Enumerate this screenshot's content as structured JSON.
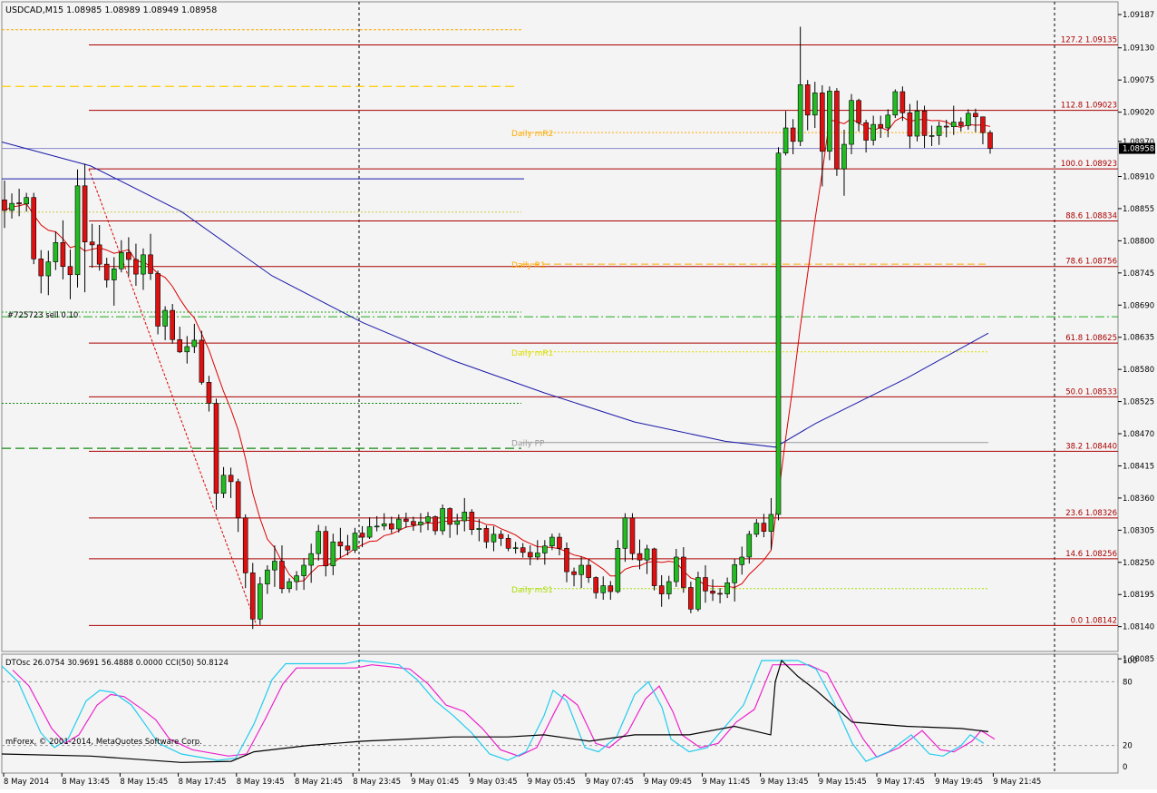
{
  "window": {
    "header": "USDCAD,M15  1.08985 1.08989 1.08949 1.08958",
    "order_label": "#725723 sell 0.10",
    "copyright": "mForex, © 2001-2014, MetaQuotes Software Corp."
  },
  "colors": {
    "background": "#f4f4f4",
    "bull_candle": "#22bb22",
    "bear_candle": "#dd1111",
    "fib": "#aa0000",
    "sma_fast": "#dd0000",
    "sma_slow": "#1a1aaa",
    "pivot_orange": "#ffaa00",
    "pivot_green": "#22aa22",
    "dtosc_fast": "#22ccee",
    "dtosc_slow": "#ee22cc",
    "cci": "#000000"
  },
  "chart_data": {
    "type": "candlestick",
    "symbol": "USDCAD",
    "timeframe": "M15",
    "ylim": [
      1.0811,
      1.09187
    ],
    "y_ticks": [
      "1.09187",
      "1.09130",
      "1.09075",
      "1.09020",
      "1.08970",
      "1.08910",
      "1.08855",
      "1.08800",
      "1.08745",
      "1.08690",
      "1.08635",
      "1.08580",
      "1.08525",
      "1.08470",
      "1.08415",
      "1.08360",
      "1.08305",
      "1.08250",
      "1.08195",
      "1.08140",
      "1.08085"
    ],
    "y_tick_values": [
      1.09187,
      1.0913,
      1.09075,
      1.0902,
      1.0897,
      1.0891,
      1.08855,
      1.088,
      1.08745,
      1.0869,
      1.08635,
      1.0858,
      1.08525,
      1.0847,
      1.08415,
      1.0836,
      1.08305,
      1.0825,
      1.08195,
      1.0814,
      1.08085
    ],
    "current_price": {
      "label": "1.08958",
      "value": 1.08958
    },
    "x_ticks": [
      "8 May 2014",
      "8 May 13:45",
      "8 May 15:45",
      "8 May 17:45",
      "8 May 19:45",
      "8 May 21:45",
      "8 May 23:45",
      "9 May 01:45",
      "9 May 03:45",
      "9 May 05:45",
      "9 May 07:45",
      "9 May 09:45",
      "9 May 11:45",
      "9 May 13:45",
      "9 May 15:45",
      "9 May 17:45",
      "9 May 19:45",
      "9 May 21:45"
    ],
    "fib_levels": [
      {
        "label": "127.2 1.09135",
        "value": 1.09135
      },
      {
        "label": "112.8 1.09023",
        "value": 1.09023
      },
      {
        "label": "100.0 1.08923",
        "value": 1.08923
      },
      {
        "label": "88.6 1.08834",
        "value": 1.08834
      },
      {
        "label": "78.6 1.08756",
        "value": 1.08756
      },
      {
        "label": "61.8 1.08625",
        "value": 1.08625
      },
      {
        "label": "50.0 1.08533",
        "value": 1.08533
      },
      {
        "label": "38.2 1.08440",
        "value": 1.0844
      },
      {
        "label": "23.6 1.08326",
        "value": 1.08326
      },
      {
        "label": "14.6 1.08256",
        "value": 1.08256
      },
      {
        "label": "0.0 1.08142",
        "value": 1.08142
      }
    ],
    "pivots": [
      {
        "label": "Daily mR2",
        "value": 1.08985,
        "color": "#ffaa00",
        "style": "dot"
      },
      {
        "label": "Daily R1",
        "value": 1.0876,
        "color": "#ffaa00",
        "style": "dash"
      },
      {
        "label": "Daily mR1",
        "value": 1.0861,
        "color": "#dddd00",
        "style": "dot"
      },
      {
        "label": "Daily PP",
        "value": 1.08455,
        "color": "#999999",
        "style": "solid"
      },
      {
        "label": "Daily mS1",
        "value": 1.08205,
        "color": "#aadd00",
        "style": "dot"
      }
    ],
    "candles": [
      [
        1.0887,
        1.08903,
        1.08822,
        1.08852
      ],
      [
        1.08852,
        1.08881,
        1.08838,
        1.08864
      ],
      [
        1.08865,
        1.08889,
        1.08842,
        1.08863
      ],
      [
        1.08863,
        1.08882,
        1.0885,
        1.08874
      ],
      [
        1.08874,
        1.08882,
        1.0876,
        1.08769
      ],
      [
        1.08769,
        1.08784,
        1.0871,
        1.0874
      ],
      [
        1.0874,
        1.08783,
        1.08707,
        1.08764
      ],
      [
        1.08764,
        1.08816,
        1.0875,
        1.08797
      ],
      [
        1.08797,
        1.08835,
        1.08734,
        1.08756
      ],
      [
        1.08756,
        1.08785,
        1.087,
        1.08742
      ],
      [
        1.08742,
        1.08922,
        1.0872,
        1.08894
      ],
      [
        1.08894,
        1.08932,
        1.08712,
        1.08798
      ],
      [
        1.08798,
        1.08829,
        1.08754,
        1.08793
      ],
      [
        1.08793,
        1.08827,
        1.08749,
        1.0876
      ],
      [
        1.0876,
        1.08771,
        1.0872,
        1.08733
      ],
      [
        1.08733,
        1.08772,
        1.08689,
        1.08752
      ],
      [
        1.08752,
        1.08801,
        1.08746,
        1.0878
      ],
      [
        1.0878,
        1.08806,
        1.0874,
        1.08768
      ],
      [
        1.08768,
        1.08795,
        1.08723,
        1.08743
      ],
      [
        1.08743,
        1.08787,
        1.08716,
        1.08776
      ],
      [
        1.08776,
        1.08812,
        1.08733,
        1.08744
      ],
      [
        1.08744,
        1.08749,
        1.0864,
        1.08654
      ],
      [
        1.08654,
        1.08688,
        1.0863,
        1.08681
      ],
      [
        1.08681,
        1.08692,
        1.08624,
        1.08631
      ],
      [
        1.08631,
        1.08653,
        1.08608,
        1.0861
      ],
      [
        1.0861,
        1.08637,
        1.0859,
        1.08619
      ],
      [
        1.08619,
        1.08658,
        1.08608,
        1.0863
      ],
      [
        1.0863,
        1.08646,
        1.08554,
        1.08558
      ],
      [
        1.08558,
        1.08569,
        1.08508,
        1.08522
      ],
      [
        1.08522,
        1.0853,
        1.0834,
        1.08368
      ],
      [
        1.08368,
        1.08413,
        1.0836,
        1.08399
      ],
      [
        1.08399,
        1.08412,
        1.0836,
        1.08388
      ],
      [
        1.08388,
        1.08393,
        1.08302,
        1.08326
      ],
      [
        1.08326,
        1.08332,
        1.08206,
        1.08232
      ],
      [
        1.08232,
        1.08249,
        1.08136,
        1.08153
      ],
      [
        1.08153,
        1.08225,
        1.08143,
        1.08213
      ],
      [
        1.08213,
        1.08245,
        1.08196,
        1.08237
      ],
      [
        1.08237,
        1.08279,
        1.08208,
        1.08252
      ],
      [
        1.08252,
        1.08279,
        1.08197,
        1.08205
      ],
      [
        1.08205,
        1.08223,
        1.08198,
        1.08217
      ],
      [
        1.08217,
        1.08235,
        1.08202,
        1.08227
      ],
      [
        1.08227,
        1.08257,
        1.08203,
        1.08245
      ],
      [
        1.08245,
        1.08282,
        1.08215,
        1.08265
      ],
      [
        1.08265,
        1.08314,
        1.08253,
        1.08303
      ],
      [
        1.08303,
        1.08312,
        1.08226,
        1.08244
      ],
      [
        1.08244,
        1.08299,
        1.08228,
        1.08285
      ],
      [
        1.08285,
        1.08309,
        1.08258,
        1.08278
      ],
      [
        1.08278,
        1.08297,
        1.08262,
        1.08271
      ],
      [
        1.08271,
        1.08309,
        1.08266,
        1.083
      ],
      [
        1.083,
        1.08312,
        1.08276,
        1.08293
      ],
      [
        1.08293,
        1.08327,
        1.0829,
        1.08311
      ],
      [
        1.08311,
        1.08329,
        1.08303,
        1.08312
      ],
      [
        1.08312,
        1.08334,
        1.08305,
        1.08316
      ],
      [
        1.08316,
        1.08328,
        1.083,
        1.08307
      ],
      [
        1.08307,
        1.08332,
        1.08301,
        1.08324
      ],
      [
        1.08324,
        1.08335,
        1.08309,
        1.0832
      ],
      [
        1.0832,
        1.08328,
        1.08304,
        1.08314
      ],
      [
        1.08314,
        1.08334,
        1.08301,
        1.08319
      ],
      [
        1.08319,
        1.08336,
        1.08305,
        1.08328
      ],
      [
        1.08328,
        1.0833,
        1.08297,
        1.08304
      ],
      [
        1.08304,
        1.08349,
        1.08297,
        1.08342
      ],
      [
        1.08342,
        1.08344,
        1.08292,
        1.08315
      ],
      [
        1.08315,
        1.08333,
        1.08297,
        1.08321
      ],
      [
        1.08321,
        1.0836,
        1.08303,
        1.08336
      ],
      [
        1.08336,
        1.08341,
        1.08297,
        1.08306
      ],
      [
        1.08306,
        1.08324,
        1.08286,
        1.08308
      ],
      [
        1.08308,
        1.08313,
        1.08274,
        1.08285
      ],
      [
        1.08285,
        1.08312,
        1.08269,
        1.08298
      ],
      [
        1.08298,
        1.08305,
        1.08278,
        1.08291
      ],
      [
        1.08291,
        1.08298,
        1.08269,
        1.08274
      ],
      [
        1.08274,
        1.08285,
        1.08265,
        1.08275
      ],
      [
        1.08275,
        1.08283,
        1.08258,
        1.08267
      ],
      [
        1.08267,
        1.08279,
        1.08245,
        1.08259
      ],
      [
        1.08259,
        1.08288,
        1.08254,
        1.08266
      ],
      [
        1.08266,
        1.08288,
        1.08246,
        1.08278
      ],
      [
        1.08278,
        1.08299,
        1.08271,
        1.08293
      ],
      [
        1.08293,
        1.083,
        1.08262,
        1.08274
      ],
      [
        1.08274,
        1.08284,
        1.08216,
        1.08234
      ],
      [
        1.08234,
        1.08241,
        1.08209,
        1.08229
      ],
      [
        1.08229,
        1.0826,
        1.08206,
        1.08245
      ],
      [
        1.08245,
        1.08256,
        1.08215,
        1.08224
      ],
      [
        1.08224,
        1.08226,
        1.08188,
        1.08198
      ],
      [
        1.08198,
        1.08226,
        1.08186,
        1.0821
      ],
      [
        1.0821,
        1.08218,
        1.08186,
        1.082
      ],
      [
        1.082,
        1.08288,
        1.08197,
        1.08274
      ],
      [
        1.08274,
        1.08334,
        1.08251,
        1.08326
      ],
      [
        1.08326,
        1.08334,
        1.08254,
        1.08265
      ],
      [
        1.08265,
        1.08289,
        1.08238,
        1.08254
      ],
      [
        1.08254,
        1.0828,
        1.0823,
        1.08273
      ],
      [
        1.08273,
        1.08275,
        1.08202,
        1.0821
      ],
      [
        1.0821,
        1.08228,
        1.08174,
        1.08196
      ],
      [
        1.08196,
        1.08227,
        1.08187,
        1.08217
      ],
      [
        1.08217,
        1.08273,
        1.08208,
        1.08259
      ],
      [
        1.08259,
        1.08276,
        1.08198,
        1.08207
      ],
      [
        1.08207,
        1.08217,
        1.08163,
        1.0817
      ],
      [
        1.0817,
        1.08234,
        1.08166,
        1.08224
      ],
      [
        1.08224,
        1.08245,
        1.08181,
        1.08201
      ],
      [
        1.08201,
        1.08221,
        1.08184,
        1.08197
      ],
      [
        1.08197,
        1.08206,
        1.0818,
        1.08196
      ],
      [
        1.08196,
        1.08224,
        1.08189,
        1.08215
      ],
      [
        1.08215,
        1.08256,
        1.08183,
        1.08246
      ],
      [
        1.08246,
        1.08277,
        1.08229,
        1.08259
      ],
      [
        1.08259,
        1.08304,
        1.08248,
        1.08298
      ],
      [
        1.08298,
        1.08324,
        1.08293,
        1.08317
      ],
      [
        1.08317,
        1.08333,
        1.08293,
        1.08303
      ],
      [
        1.08303,
        1.0836,
        1.08272,
        1.08332
      ],
      [
        1.08332,
        1.0896,
        1.08322,
        1.0895
      ],
      [
        1.0895,
        1.09022,
        1.08946,
        1.08993
      ],
      [
        1.08993,
        1.09008,
        1.08948,
        1.0897
      ],
      [
        1.0897,
        1.09166,
        1.08962,
        1.09067
      ],
      [
        1.09067,
        1.09075,
        1.08989,
        1.09015
      ],
      [
        1.09015,
        1.09072,
        1.08993,
        1.09053
      ],
      [
        1.09053,
        1.09066,
        1.08893,
        1.08953
      ],
      [
        1.08953,
        1.09064,
        1.08938,
        1.09056
      ],
      [
        1.09056,
        1.09061,
        1.08911,
        1.08923
      ],
      [
        1.08923,
        1.0899,
        1.08877,
        1.08965
      ],
      [
        1.08965,
        1.09051,
        1.08948,
        1.0904
      ],
      [
        1.0904,
        1.09043,
        1.08987,
        1.09002
      ],
      [
        1.09002,
        1.09007,
        1.08951,
        1.08972
      ],
      [
        1.08972,
        1.09014,
        1.08963,
        1.08999
      ],
      [
        1.08999,
        1.09014,
        1.08976,
        1.08993
      ],
      [
        1.08993,
        1.09025,
        1.08977,
        1.09015
      ],
      [
        1.09015,
        1.09059,
        1.0901,
        1.09055
      ],
      [
        1.09055,
        1.09064,
        1.09005,
        1.09019
      ],
      [
        1.09019,
        1.09034,
        1.08958,
        1.08979
      ],
      [
        1.08979,
        1.0904,
        1.0897,
        1.09022
      ],
      [
        1.09022,
        1.09031,
        1.08959,
        1.0898
      ],
      [
        1.0898,
        1.08997,
        1.08962,
        1.0898
      ],
      [
        1.0898,
        1.09004,
        1.08964,
        1.08996
      ],
      [
        1.08996,
        1.09007,
        1.08977,
        1.08995
      ],
      [
        1.08995,
        1.09031,
        1.08981,
        1.09003
      ],
      [
        1.09003,
        1.09011,
        1.08987,
        1.08997
      ],
      [
        1.08997,
        1.09025,
        1.0899,
        1.09018
      ],
      [
        1.09018,
        1.09026,
        1.08986,
        1.09012
      ],
      [
        1.09012,
        1.09012,
        1.08965,
        1.08985
      ],
      [
        1.08985,
        1.08989,
        1.08949,
        1.08958
      ]
    ],
    "indicator": {
      "label": "DTOsc 26.0754 30.9691 56.4888 0.0000  CCI(50) 50.8124",
      "ylim": [
        0,
        100
      ],
      "levels": [
        80,
        20
      ],
      "ticks": [
        "100",
        "80",
        "20",
        "0"
      ],
      "tick_values": [
        100,
        80,
        20,
        0
      ]
    }
  }
}
